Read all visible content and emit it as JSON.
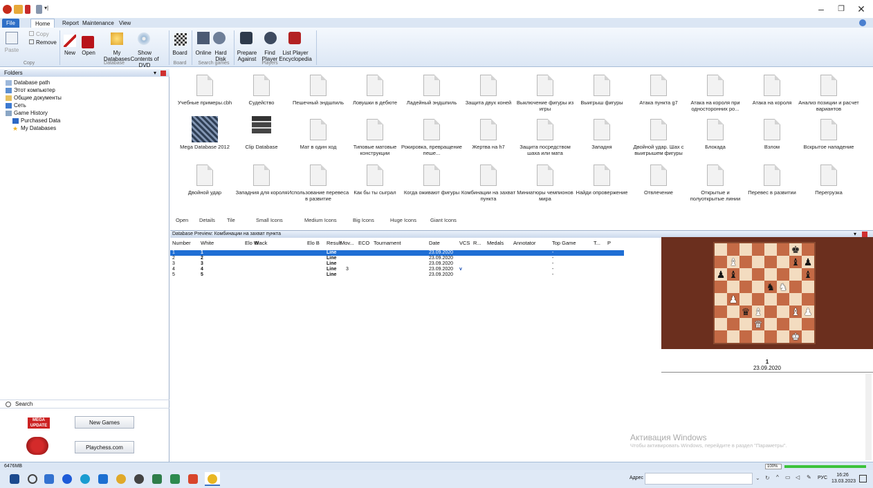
{
  "ribbon": {
    "tabs": [
      "File",
      "Home",
      "Report",
      "Maintenance",
      "View"
    ],
    "copy": "Copy",
    "remove": "Remove",
    "paste": "Paste",
    "new": "New",
    "open": "Open",
    "my_databases": "My Databases",
    "show_contents": "Show Contents of DVD",
    "board": "Board",
    "online": "Online",
    "hard_disk": "Hard Disk",
    "prepare_against": "Prepare Against",
    "find_player": "Find Player",
    "list_player_encyclopedia": "List Player Encyclopedia",
    "groups": {
      "copy": "Copy",
      "database": "Database",
      "board": "Board",
      "search_games": "Search games",
      "players": "Players"
    }
  },
  "sidebar": {
    "header": "Folders",
    "items": [
      "Database path",
      "Этот компьютер",
      "Общие документы",
      "Сеть",
      "Game History",
      "Purchased Data",
      "My Databases"
    ],
    "search": "Search",
    "new_games": "New Games",
    "playchess": "Playchess.com",
    "mega_update": "MEGA UPDATE"
  },
  "files": [
    "Учебные примеры.cbh",
    "Судейство",
    "Пешечный эндшпиль",
    "Ловушки в дебюте",
    "Ладейный эндшпиль",
    "Защита двух коней",
    "Выключение фигуры из игры",
    "Выигрыш фигуры",
    "Атака пункта g7",
    "Атака на короля при односторонних ро...",
    "Атака на короля",
    "Анализ позиции и расчет вариантов",
    "Mega Database 2012",
    "Clip Database",
    "Мат в один ход",
    "Типовые матовые конструкции",
    "Рокировка, превращение пеше...",
    "Жертва на h7",
    "Защита посредством шаха или мата",
    "Западня",
    "Двойной удар. Шах с выигрышем фигуры",
    "Блокада",
    "Взлом",
    "Вскрытое нападение",
    "Двойной удар",
    "Западния для короля",
    "Использование перевеса в развитие",
    "Как бы ты сыграл",
    "Когда оживают фигуры",
    "Комбинации на захват пункта",
    "Миниатюры чемпионов мира",
    "Найди опровержение",
    "Отвлечение",
    "Открытые и полуоткрытые линии",
    "Перевес в развитии",
    "Перегрузка"
  ],
  "viewbar": [
    "Open",
    "Details",
    "Tile",
    "Small Icons",
    "Medium Icons",
    "Big Icons",
    "Huge Icons",
    "Giant Icons"
  ],
  "preview": {
    "title": "Database Preview: Комбинации на захват пункта",
    "columns": [
      "Number",
      "White",
      "Elo W",
      "Black",
      "Elo B",
      "Result",
      "Mov...",
      "ECO",
      "Tournament",
      "Date",
      "VCS",
      "R...",
      "Medals",
      "Annotator",
      "Top Game",
      "T...",
      "P"
    ],
    "rows": [
      {
        "num": "1",
        "white": "1",
        "result": "Line",
        "mov": "",
        "date": "23.09.2020",
        "vcs": "",
        "top": "-"
      },
      {
        "num": "2",
        "white": "2",
        "result": "Line",
        "mov": "",
        "date": "23.09.2020",
        "vcs": "",
        "top": "-"
      },
      {
        "num": "3",
        "white": "3",
        "result": "Line",
        "mov": "",
        "date": "23.09.2020",
        "vcs": "",
        "top": "-"
      },
      {
        "num": "4",
        "white": "4",
        "result": "Line",
        "mov": "3",
        "date": "23.09.2020",
        "vcs": "v",
        "top": "-"
      },
      {
        "num": "5",
        "white": "5",
        "result": "Line",
        "mov": "",
        "date": "23.09.2020",
        "vcs": "",
        "top": "-"
      }
    ],
    "game_number": "1",
    "game_date": "23.09.2020"
  },
  "board_position": [
    [
      "",
      "",
      "",
      "",
      "",
      "",
      "bk",
      ""
    ],
    [
      "",
      "wb",
      "",
      "",
      "",
      "",
      "bb",
      "bp"
    ],
    [
      "bp",
      "bb",
      "",
      "",
      "",
      "",
      "",
      "bb"
    ],
    [
      "",
      "",
      "",
      "",
      "bn",
      "wn",
      "",
      ""
    ],
    [
      "",
      "wp",
      "",
      "",
      "",
      "",
      "",
      ""
    ],
    [
      "",
      "",
      "bq",
      "wb",
      "",
      "",
      "wb",
      "wp"
    ],
    [
      "",
      "",
      "",
      "wq",
      "",
      "",
      "",
      ""
    ],
    [
      "",
      "",
      "",
      "",
      "",
      "",
      "wk",
      ""
    ]
  ],
  "watermark": {
    "line1": "Активация Windows",
    "line2": "Чтобы активировать Windows, перейдите в раздел \"Параметры\"."
  },
  "status": {
    "memory": "6476MB",
    "zoom": "100%"
  },
  "taskbar": {
    "address_label": "Адрес",
    "lang": "РУС",
    "time": "16:26",
    "date": "13.03.2023"
  }
}
